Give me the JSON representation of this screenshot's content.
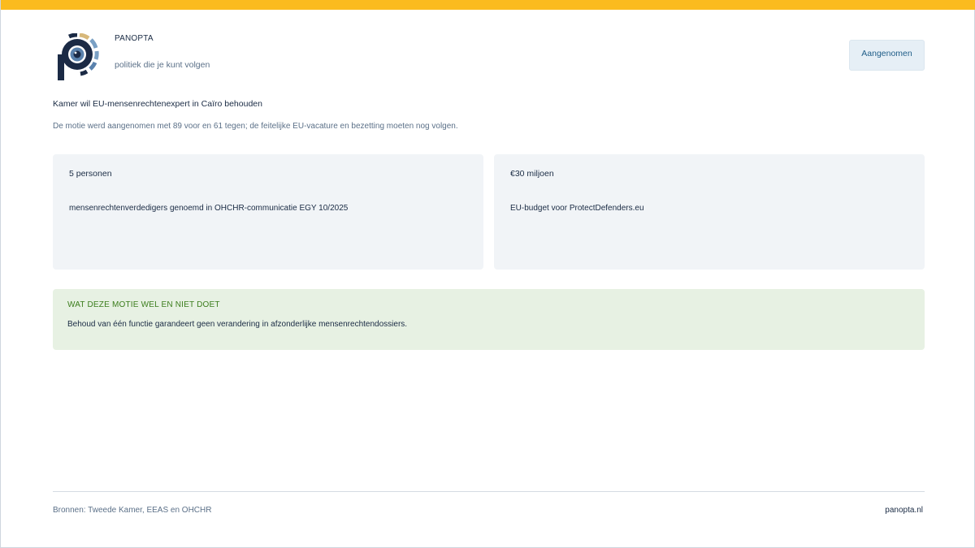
{
  "brand": {
    "name": "PANOPTA",
    "tagline": "politiek die je kunt volgen"
  },
  "status": {
    "label": "Aangenomen"
  },
  "headline": "Kamer wil EU-mensenrechtenexpert in Caïro behouden",
  "summary": "De motie werd aangenomen met 89 voor en 61 tegen; de feitelijke EU-vacature en bezetting moeten nog volgen.",
  "stats": [
    {
      "value": "5 personen",
      "description": "mensenrechtenverdedigers genoemd in OHCHR-communicatie EGY 10/2025"
    },
    {
      "value": "€30 miljoen",
      "description": "EU-budget voor ProtectDefenders.eu"
    }
  ],
  "note": {
    "title": "WAT DEZE MOTIE WEL EN NIET DOET",
    "text": "Behoud van één functie garandeert geen verandering in afzonderlijke mensenrechtendossiers."
  },
  "footer": {
    "sources": "Bronnen: Tweede Kamer, EEAS en OHCHR",
    "site": "panopta.nl"
  },
  "colors": {
    "accent": "#fbbb1e",
    "logo_navy": "#1b2a45",
    "logo_gold": "#d7b87a",
    "logo_blue": "#7aa0c4",
    "note_green": "#3b7d1c"
  },
  "icons": {
    "logo": "panopta-eye-logo"
  }
}
